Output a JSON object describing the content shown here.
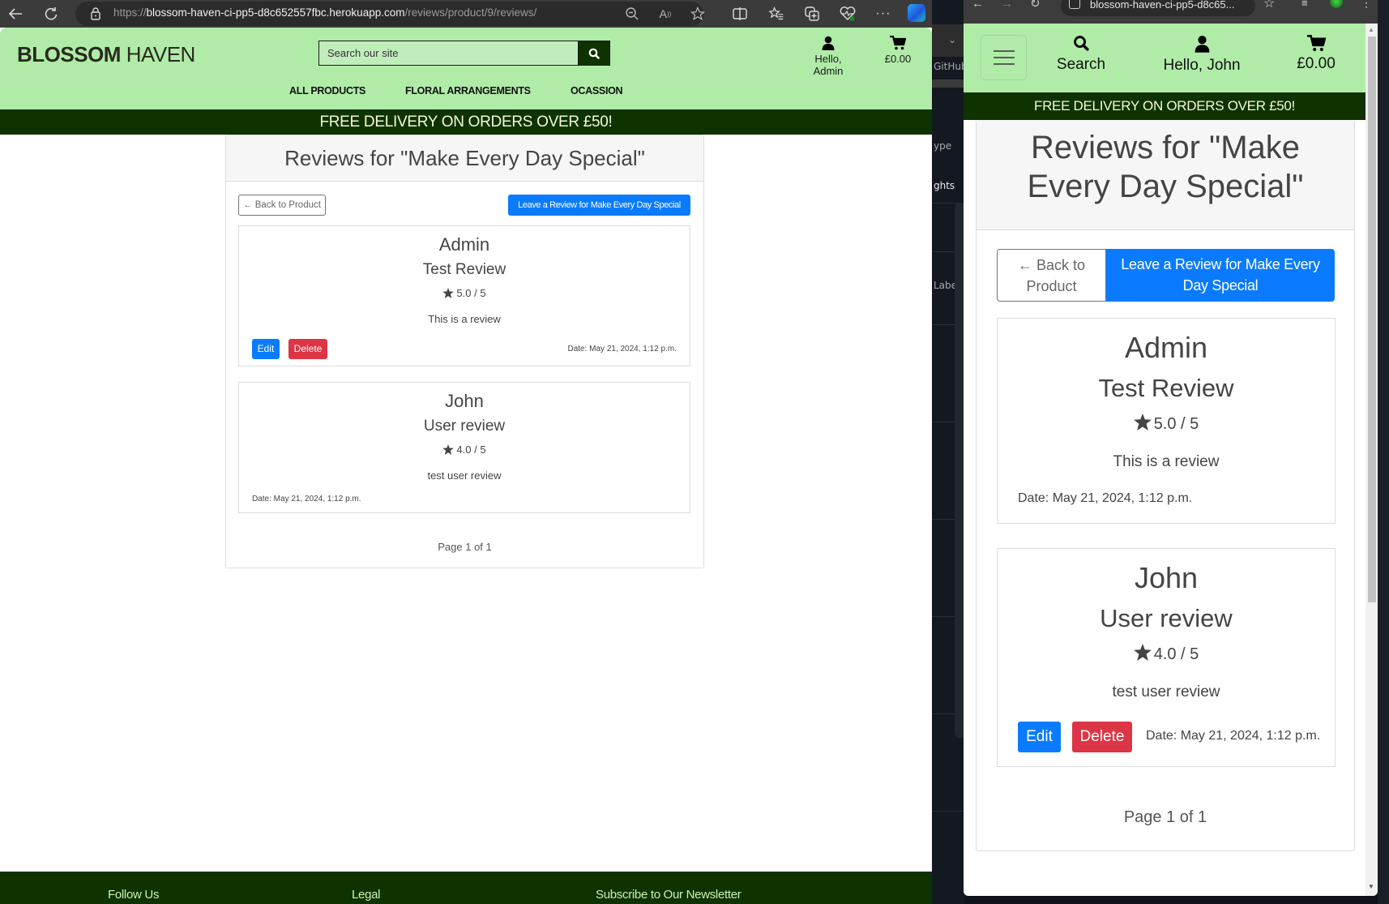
{
  "left_browser": {
    "url_scheme": "https://",
    "url_host": "blossom-haven-ci-pp5-d8c652557fbc.herokuapp.com",
    "url_path": "/reviews/product/9/reviews/",
    "toolbar_icons": [
      "back-icon",
      "refresh-icon",
      "lock-icon",
      "zoom-out-icon",
      "read-aloud-icon",
      "favorite-star-icon",
      "split-screen-icon",
      "favorites-list-icon",
      "collections-icon",
      "browser-essentials-icon",
      "more-icon",
      "copilot-icon"
    ]
  },
  "site": {
    "logo_bold": "BLOSSOM",
    "logo_light": "HAVEN",
    "search_placeholder": "Search our site",
    "account_label_admin": "Hello, Admin",
    "cart_total": "£0.00",
    "nav": [
      "ALL PRODUCTS",
      "FLORAL ARRANGEMENTS",
      "OCASSION"
    ],
    "delivery_banner": "FREE DELIVERY ON ORDERS OVER £50!",
    "colors": {
      "header_bg": "#b0eca8",
      "dark_green": "#0f3300",
      "primary": "#0a7bff",
      "danger": "#dc3545"
    }
  },
  "page": {
    "title": "Reviews for \"Make Every Day Special\"",
    "back_button": "Back to Product",
    "leave_review_button": "Leave a Review for Make Every Day Special",
    "edit_label": "Edit",
    "delete_label": "Delete",
    "pagination": "Page 1 of 1",
    "reviews": [
      {
        "author": "Admin",
        "title": "Test Review",
        "rating": "5.0 / 5",
        "body": "This is a review",
        "date": "Date: May 21, 2024, 1:12 p.m."
      },
      {
        "author": "John",
        "title": "User review",
        "rating": "4.0 / 5",
        "body": "test user review",
        "date": "Date: May 21, 2024, 1:12 p.m."
      }
    ]
  },
  "footer": {
    "headings": [
      "Follow Us",
      "Legal",
      "Subscribe to Our Newsletter"
    ]
  },
  "background_app": {
    "fragments": [
      "GitHub",
      "ype",
      "ghts",
      "Labe"
    ]
  },
  "right_browser": {
    "url": "blossom-haven-ci-pp5-d8c65...",
    "search_label": "Search",
    "account_label_john": "Hello, John",
    "cart_total": "£0.00"
  }
}
